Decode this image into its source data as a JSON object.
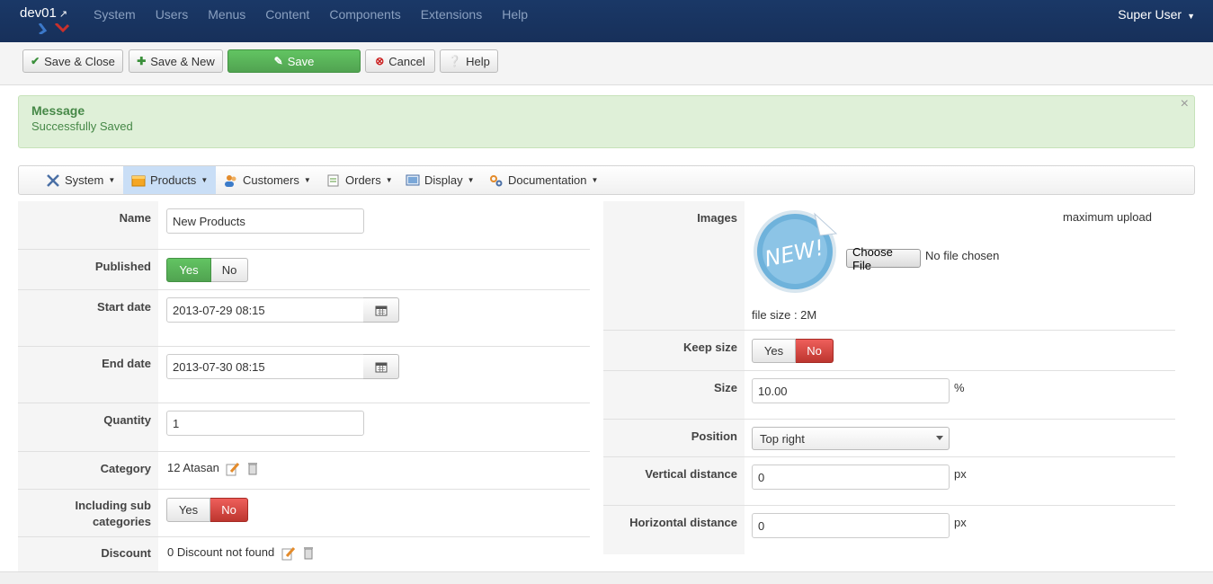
{
  "navbar": {
    "brand": "dev01",
    "menu": [
      "System",
      "Users",
      "Menus",
      "Content",
      "Components",
      "Extensions",
      "Help"
    ],
    "user": "Super User"
  },
  "toolbar": {
    "save_close": "Save & Close",
    "save_new": "Save & New",
    "save": "Save",
    "cancel": "Cancel",
    "help": "Help"
  },
  "message": {
    "title": "Message",
    "text": "Successfully Saved",
    "close": "×"
  },
  "submenu": [
    "System",
    "Products",
    "Customers",
    "Orders",
    "Display",
    "Documentation"
  ],
  "form": {
    "name_label": "Name",
    "name_value": "New Products",
    "published_label": "Published",
    "yes": "Yes",
    "no": "No",
    "start_label": "Start date",
    "start_value": "2013-07-29 08:15",
    "end_label": "End date",
    "end_value": "2013-07-30 08:15",
    "quantity_label": "Quantity",
    "quantity_value": "1",
    "category_label": "Category",
    "category_value": "12 Atasan",
    "subcat_label_1": "Including sub",
    "subcat_label_2": "categories",
    "discount_label": "Discount",
    "discount_value": "0 Discount not found"
  },
  "right": {
    "images_label": "Images",
    "max_upload": "maximum upload",
    "choose_file": "Choose File",
    "no_file": "No file chosen",
    "file_size": "file size : 2M",
    "badge_text": "NEW!",
    "keep_size_label": "Keep size",
    "size_label": "Size",
    "size_value": "10.00",
    "size_unit": "%",
    "position_label": "Position",
    "position_value": "Top right",
    "vdist_label": "Vertical distance",
    "vdist_value": "0",
    "hdist_label": "Horizontal distance",
    "hdist_value": "0",
    "px": "px"
  },
  "colors": {
    "navbar": "#17305a",
    "green": "#51a351",
    "red": "#bd362f",
    "message_bg": "#dff0d8",
    "message_text": "#468847"
  }
}
